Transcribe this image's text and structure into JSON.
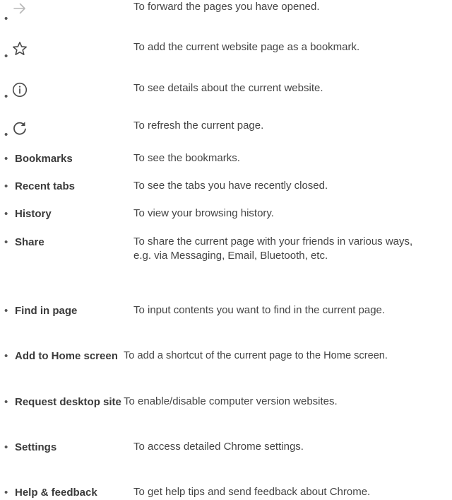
{
  "bullet_char": "•",
  "icon_rows": [
    {
      "icon": "arrow-forward-icon",
      "description": "To forward the pages you have opened."
    },
    {
      "icon": "star-icon",
      "description": "To add the current website page as a bookmark."
    },
    {
      "icon": "info-icon",
      "description": "To see details about the current website."
    },
    {
      "icon": "refresh-icon",
      "description": "To refresh the current page."
    }
  ],
  "menu_rows": [
    {
      "label": "Bookmarks",
      "description": "To see the bookmarks."
    },
    {
      "label": "Recent tabs",
      "description": "To see the tabs you have recently closed."
    },
    {
      "label": "History",
      "description": "To view your browsing history."
    },
    {
      "label": "Share",
      "description": "To share the current page with your friends in various ways, e.g. via Messaging, Email, Bluetooth, etc."
    },
    {
      "label": "Find in page",
      "description": "To input contents you want to find in the current page."
    },
    {
      "label": "Add to Home screen",
      "description": "To add a shortcut of the current page to the Home screen."
    },
    {
      "label": "Request desktop site",
      "description": "To enable/disable computer version websites."
    },
    {
      "label": "Settings",
      "description": "To access detailed Chrome settings."
    },
    {
      "label": "Help & feedback",
      "description": "To get help tips and send feedback about Chrome."
    }
  ],
  "colors": {
    "text": "#3a3a3a",
    "icon_active": "#4a4a4a",
    "icon_disabled": "#b8b8b8"
  }
}
